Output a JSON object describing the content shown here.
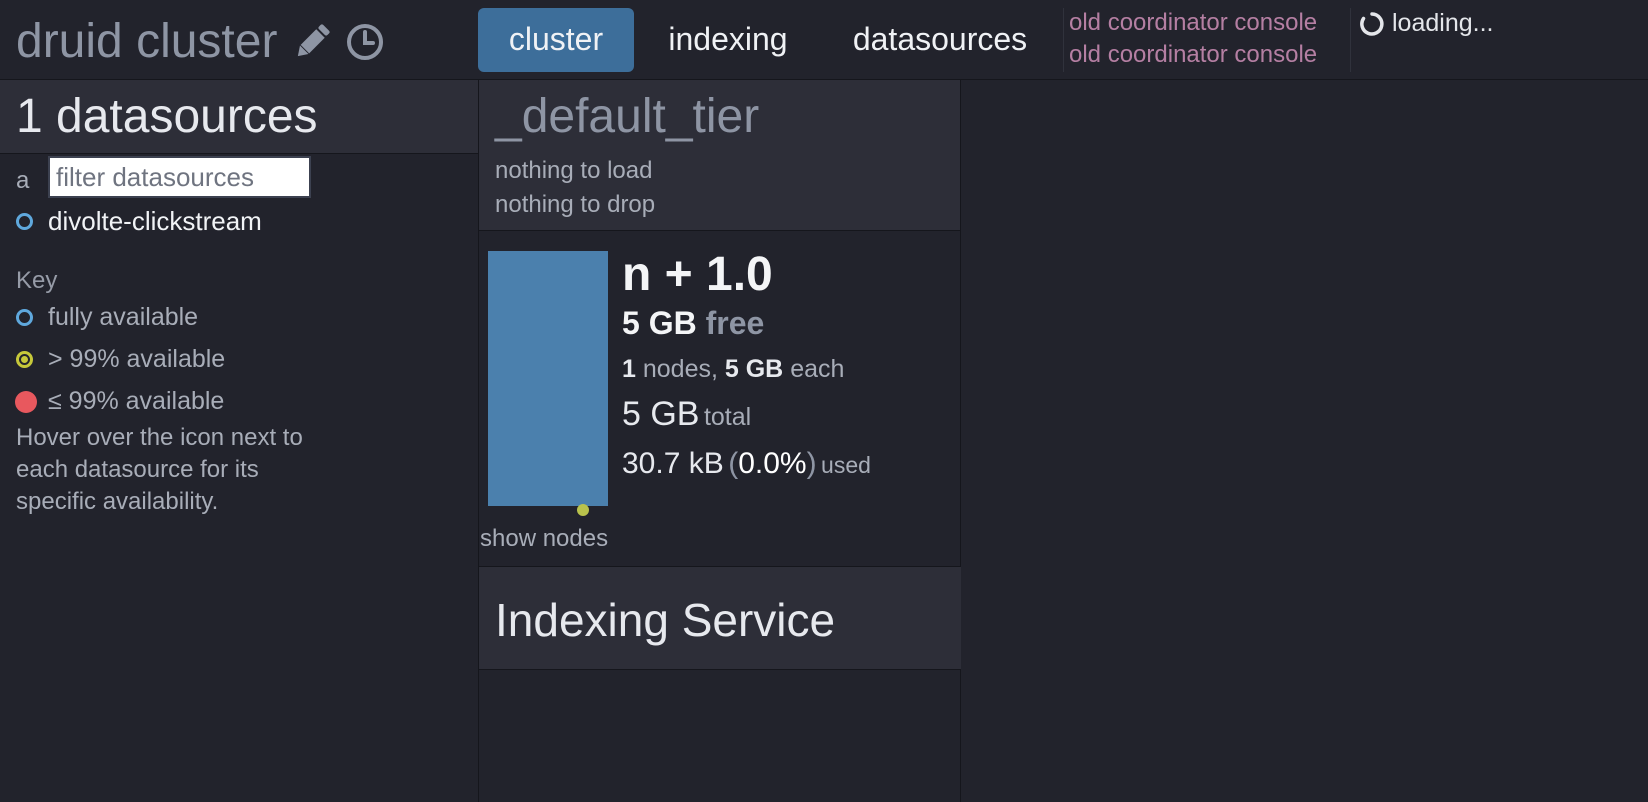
{
  "header": {
    "brand": "druid cluster",
    "tabs": [
      {
        "label": "cluster",
        "active": true
      },
      {
        "label": "indexing",
        "active": false
      },
      {
        "label": "datasources",
        "active": false
      }
    ],
    "old_console_links": [
      "old coordinator console",
      "old coordinator console"
    ],
    "loading_text": "loading..."
  },
  "sidebar": {
    "title": "1 datasources",
    "filter_prefix": "a",
    "filter_placeholder": "filter datasources",
    "datasources": [
      {
        "name": "divolte-clickstream",
        "status": "fully available"
      }
    ],
    "key": {
      "title": "Key",
      "items": [
        {
          "label": "fully available",
          "color": "#5fa8dd"
        },
        {
          "label": "> 99% available",
          "color": "#c6c83a"
        },
        {
          "label": "≤ 99% available",
          "color": "#e8585e"
        }
      ],
      "note": "Hover over the icon next to each datasource for its specific availability."
    }
  },
  "tier": {
    "name": "_default_tier",
    "load_status": "nothing to load",
    "drop_status": "nothing to drop",
    "replication": "n + 1.0",
    "free_value": "5 GB",
    "free_label": "free",
    "node_count": "1",
    "nodes_label": "nodes,",
    "per_node_size": "5 GB",
    "each_label": "each",
    "total_value": "5 GB",
    "total_label": "total",
    "used_value": "30.7 kB",
    "used_percent": "0.0%",
    "used_label": "used",
    "used_fraction": 0.0,
    "bar_color": "#4b80ad",
    "show_nodes_label": "show nodes"
  },
  "indexing_service": {
    "title": "Indexing Service"
  },
  "colors": {
    "background": "#22232c",
    "panel": "#2d2e38",
    "active_tab": "#3d6e9a",
    "link": "#b57fa3"
  }
}
